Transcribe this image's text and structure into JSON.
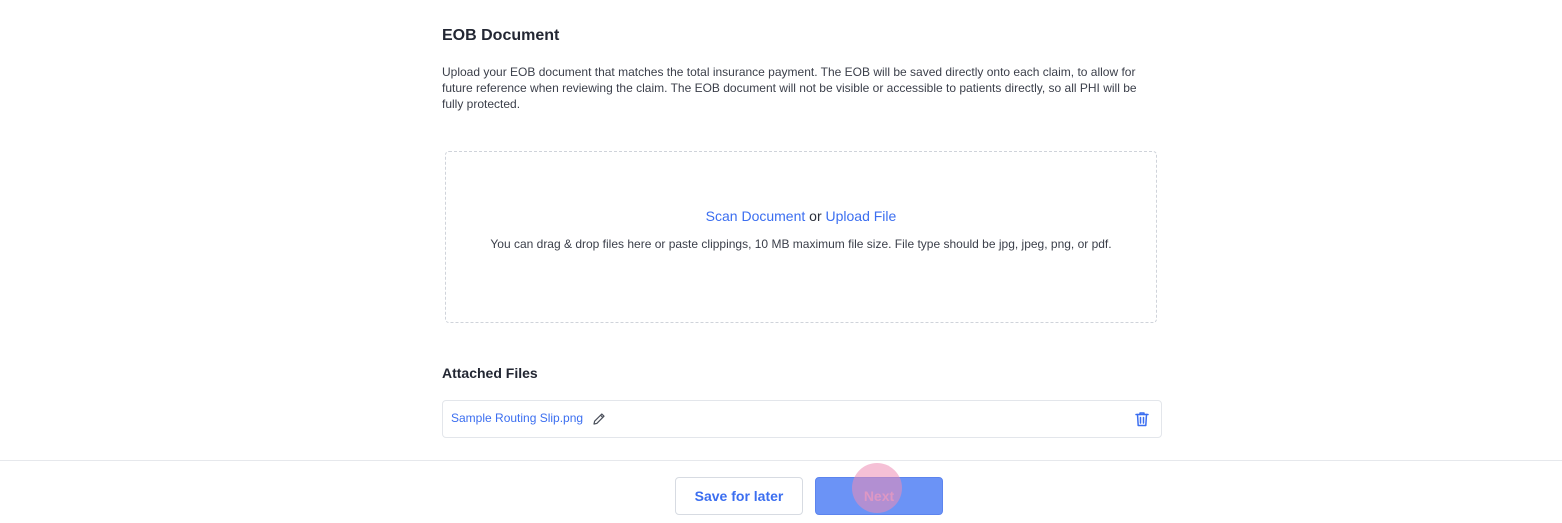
{
  "section": {
    "title": "EOB Document",
    "description": "Upload your EOB document that matches the total insurance payment. The EOB will be saved directly onto each claim, to allow for future reference when reviewing the claim. The EOB document will not be visible or accessible to patients directly, so all PHI will be fully protected."
  },
  "dropzone": {
    "scan_label": "Scan Document",
    "separator": "or",
    "upload_label": "Upload File",
    "hint": "You can drag & drop files here or paste clippings, 10 MB maximum file size. File type should be jpg, jpeg, png, or pdf."
  },
  "attached": {
    "title": "Attached Files",
    "files": [
      {
        "name": "Sample Routing Slip.png",
        "edit_icon": "pencil-icon",
        "delete_icon": "trash-icon"
      }
    ]
  },
  "footer": {
    "save_label": "Save for later",
    "next_label": "Next"
  },
  "colors": {
    "link": "#3b6ef0",
    "primary_button": "#6b93f6",
    "border": "#e3e6eb"
  }
}
